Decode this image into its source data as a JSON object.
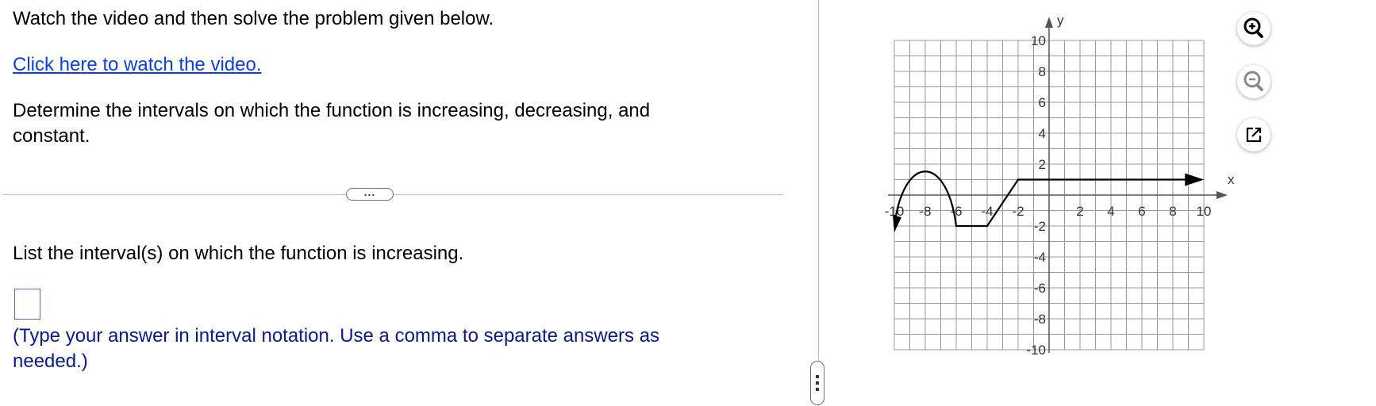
{
  "question": {
    "intro": "Watch the video and then solve the problem given below.",
    "video_link": "Click here to watch the video.",
    "text": "Determine the intervals on which the function is increasing, decreasing, and constant.",
    "expand_label": "...",
    "prompt": "List the interval(s) on which the function is  increasing.",
    "answer_value": "",
    "hint": "(Type your answer in interval notation. Use a comma to separate answers as needed.)"
  },
  "graph": {
    "x_label": "x",
    "y_label": "y",
    "x_range": [
      -10,
      10
    ],
    "y_range": [
      -10,
      10
    ],
    "x_ticks": [
      "-10",
      "-8",
      "-6",
      "-4",
      "-2",
      "2",
      "4",
      "6",
      "8",
      "10"
    ],
    "y_ticks": [
      "10",
      "8",
      "6",
      "4",
      "2",
      "-2",
      "-4",
      "-6",
      "-8",
      "-10"
    ],
    "grid": true,
    "curve": {
      "start": [
        -10,
        -2
      ],
      "arc_peak": [
        -8,
        2
      ],
      "flat_segment": [
        [
          -6,
          -2
        ],
        [
          -4,
          -2
        ]
      ],
      "rise_to": [
        -2,
        1
      ],
      "constant_until_arrow": [
        9.5,
        1
      ]
    }
  },
  "tools": {
    "zoom_in": "zoom-in-icon",
    "zoom_out": "zoom-out-icon",
    "popout": "popout-icon"
  }
}
